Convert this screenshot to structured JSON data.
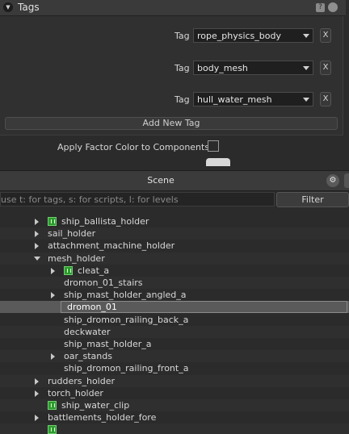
{
  "tags_panel": {
    "title": "Tags",
    "help_glyph": "?",
    "rows": [
      {
        "label": "Tag",
        "value": "rope_physics_body",
        "remove": "X"
      },
      {
        "label": "Tag",
        "value": "body_mesh",
        "remove": "X"
      },
      {
        "label": "Tag",
        "value": "hull_water_mesh",
        "remove": "X"
      }
    ],
    "add_button": "Add New Tag",
    "apply_factor_label": "Apply Factor Color to Components",
    "apply_factor_checked": false
  },
  "scene_panel": {
    "title": "Scene",
    "search_placeholder": "use t: for tags, s: for scripts, l: for levels",
    "filter_button": "Filter",
    "tree": [
      {
        "label": "ship_ballista_holder",
        "depth": 1,
        "expander": "collapsed",
        "icon": "entity-icon"
      },
      {
        "label": "sail_holder",
        "depth": 1,
        "expander": "collapsed"
      },
      {
        "label": "attachment_machine_holder",
        "depth": 1,
        "expander": "collapsed"
      },
      {
        "label": "mesh_holder",
        "depth": 1,
        "expander": "expanded"
      },
      {
        "label": "cleat_a",
        "depth": 2,
        "expander": "collapsed",
        "icon": "entity-icon"
      },
      {
        "label": "dromon_01_stairs",
        "depth": 2
      },
      {
        "label": "ship_mast_holder_angled_a",
        "depth": 2,
        "expander": "collapsed"
      },
      {
        "label": "dromon_01",
        "depth": 2,
        "selected": true
      },
      {
        "label": "ship_dromon_railing_back_a",
        "depth": 2
      },
      {
        "label": "deckwater",
        "depth": 2
      },
      {
        "label": "ship_mast_holder_a",
        "depth": 2
      },
      {
        "label": "oar_stands",
        "depth": 2,
        "expander": "collapsed"
      },
      {
        "label": "ship_dromon_railing_front_a",
        "depth": 2
      },
      {
        "label": "rudders_holder",
        "depth": 1,
        "expander": "collapsed"
      },
      {
        "label": "torch_holder",
        "depth": 1,
        "expander": "collapsed"
      },
      {
        "label": "ship_water_clip",
        "depth": 1,
        "icon": "entity-icon"
      },
      {
        "label": "battlements_holder_fore",
        "depth": 1,
        "expander": "collapsed"
      },
      {
        "label": "",
        "depth": 1,
        "icon": "entity-icon"
      }
    ]
  },
  "colors": {
    "background": "#2b2b2b",
    "panel": "#303030",
    "selected_row": "#5a5a5a",
    "entity_icon": "#2f9a2f"
  }
}
